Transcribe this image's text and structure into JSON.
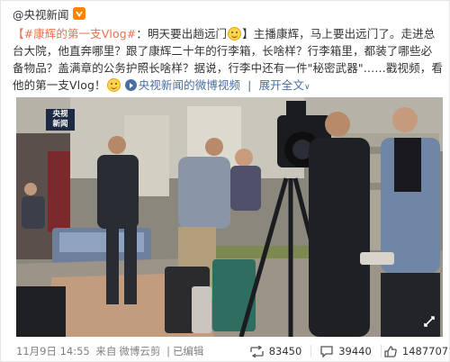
{
  "post": {
    "author": "@央视新闻",
    "author_badge_icon": "weibo-vip-icon",
    "text": {
      "hashtag": "【#康辉的第一支Vlog#",
      "part1": "：明天要出趟远门",
      "part2": "】主播康辉，马上要出远门了。走进总台大院，他直奔哪里？跟了康辉二十年的行李箱，长啥样？行李箱里，都装了哪些必备物品？盖满章的公务护照长啥样？据说，行李中还有一件\"秘密武器\"……戳视频，",
      "part3": "看他的第一支Vlog！",
      "video_link": "央视新闻的微博视频",
      "expand": "展开全文",
      "expand_icon": "chevron-down"
    },
    "video": {
      "logo_line1": "央视",
      "logo_line2": "新闻",
      "accent": "#1d2a44"
    },
    "footer": {
      "date": "11月9日 14:55",
      "source_prefix": "来自",
      "source": "微博云剪",
      "edited": "已编辑",
      "reposts": "83450",
      "comments": "39440",
      "likes": "1487707"
    },
    "colors": {
      "link": "#eb7350",
      "blue_link": "#476fa0",
      "muted": "#808080"
    }
  }
}
